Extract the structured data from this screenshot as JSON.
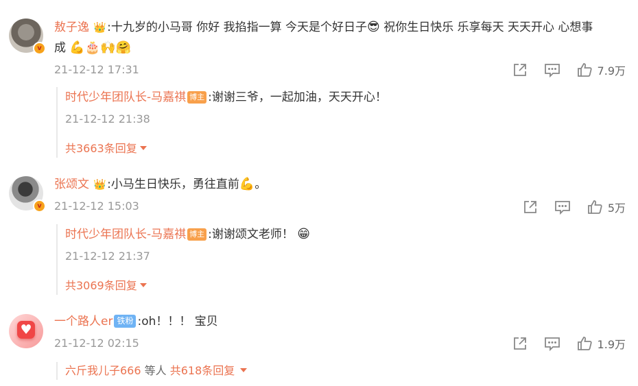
{
  "comments": [
    {
      "username": "敖子逸",
      "text_a": ":十九岁的小马哥 你好 我掐指一算 今天是个好日子",
      "text_b": " 祝你生日快乐 乐享每天 天天开心 心想事",
      "text_c": "成",
      "time": "21-12-12 17:31",
      "likes": "7.9万",
      "reply": {
        "username": "时代少年团队长-马嘉祺",
        "tag": "博主",
        "text": ":谢谢三爷，一起加油，天天开心！",
        "time": "21-12-12 21:38"
      },
      "more": "共3663条回复"
    },
    {
      "username": "张颂文",
      "text_a": ":小马生日快乐，勇往直前",
      "text_b": "。",
      "time": "21-12-12 15:03",
      "likes": "5万",
      "reply": {
        "username": "时代少年团队长-马嘉祺",
        "tag": "博主",
        "text": ":谢谢颂文老师！",
        "time": "21-12-12 21:37"
      },
      "more": "共3069条回复"
    },
    {
      "username": "一个路人er",
      "tag": "铁粉",
      "text": ":oh！！！ 宝贝",
      "time": "21-12-12 02:15",
      "likes": "1.9万",
      "more_user": "六斤我儿子666",
      "more_mid": " 等人 ",
      "more": "共618条回复"
    }
  ],
  "emoji": {
    "cool": "😎",
    "muscle": "💪",
    "cake": "🎂",
    "clap": "🙌",
    "hug": "🤗",
    "grin": "😁",
    "crown": "👑"
  },
  "colors": {
    "accent": "#eb7350",
    "muted": "#999999",
    "fan_tag": "#6fb3f4",
    "blogger_tag": "#f8a04b"
  }
}
